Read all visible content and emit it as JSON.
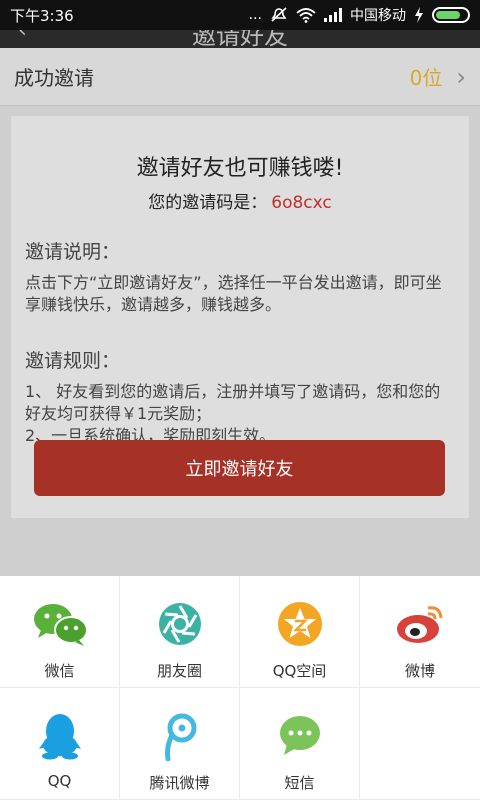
{
  "status_bar": {
    "time": "下午3:36",
    "carrier": "中国移动",
    "dots": "...",
    "icons": [
      "mute-icon",
      "wifi-icon",
      "signal-icon",
      "charging-icon",
      "battery-icon"
    ]
  },
  "header": {
    "title": "邀请好友"
  },
  "success_row": {
    "label": "成功邀请",
    "count": "0位"
  },
  "card": {
    "headline": "邀请好友也可赚钱喽!",
    "code_prefix": "您的邀请码是：",
    "code_value": "6o8cxc",
    "instructions_title": "邀请说明：",
    "instructions_body": "点击下方“立即邀请好友”，选择任一平台发出邀请，即可坐享赚钱快乐，邀请越多，赚钱越多。",
    "rules_title": "邀请规则：",
    "rules_item_1": "1、 好友看到您的邀请后，注册并填写了邀请码，您和您的好友均可获得￥1元奖励；",
    "rules_item_2": "2、一旦系统确认，奖励即刻生效。",
    "button_label": "立即邀请好友"
  },
  "share_targets": [
    {
      "label": "微信",
      "icon": "wechat-icon",
      "color": "#59b13a"
    },
    {
      "label": "朋友圈",
      "icon": "moments-icon",
      "color": "#3bb3a4"
    },
    {
      "label": "QQ空间",
      "icon": "qzone-icon",
      "color": "#f2a623"
    },
    {
      "label": "微博",
      "icon": "weibo-icon",
      "color": "#d9423a"
    },
    {
      "label": "QQ",
      "icon": "qq-icon",
      "color": "#1a9fe0"
    },
    {
      "label": "腾讯微博",
      "icon": "tencent-weibo-icon",
      "color": "#43b8e0"
    },
    {
      "label": "短信",
      "icon": "sms-icon",
      "color": "#7cc35a"
    }
  ],
  "colors": {
    "accent_button": "#a63126",
    "invite_code": "#c0302b",
    "count": "#d8a92b"
  }
}
